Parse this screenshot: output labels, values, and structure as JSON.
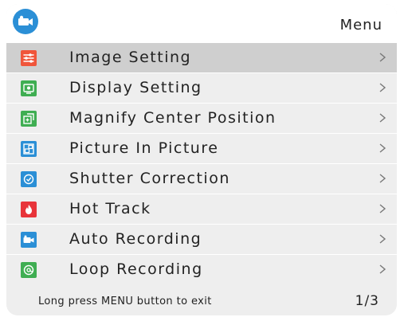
{
  "header": {
    "title": "Menu",
    "logo_icon": "camera-icon"
  },
  "colors": {
    "accent": "#2b8fd6",
    "selected": "#cfcfcf",
    "panel": "#eeeeee"
  },
  "menu": {
    "items": [
      {
        "label": "Image Setting",
        "icon": "sliders-icon",
        "color": "#f0553a",
        "selected": true
      },
      {
        "label": "Display Setting",
        "icon": "display-icon",
        "color": "#3fae52"
      },
      {
        "label": "Magnify Center Position",
        "icon": "magnify-icon",
        "color": "#3fae52"
      },
      {
        "label": "Picture  In  Picture",
        "icon": "pip-icon",
        "color": "#2b8fd6"
      },
      {
        "label": "Shutter Correction",
        "icon": "shutter-icon",
        "color": "#2b8fd6"
      },
      {
        "label": "Hot Track",
        "icon": "flame-icon",
        "color": "#e8343a"
      },
      {
        "label": "Auto Recording",
        "icon": "video-icon",
        "color": "#2b8fd6"
      },
      {
        "label": "Loop Recording",
        "icon": "loop-icon",
        "color": "#3fae52"
      }
    ]
  },
  "footer": {
    "hint": "Long press MENU button to exit",
    "page": "1/3"
  }
}
